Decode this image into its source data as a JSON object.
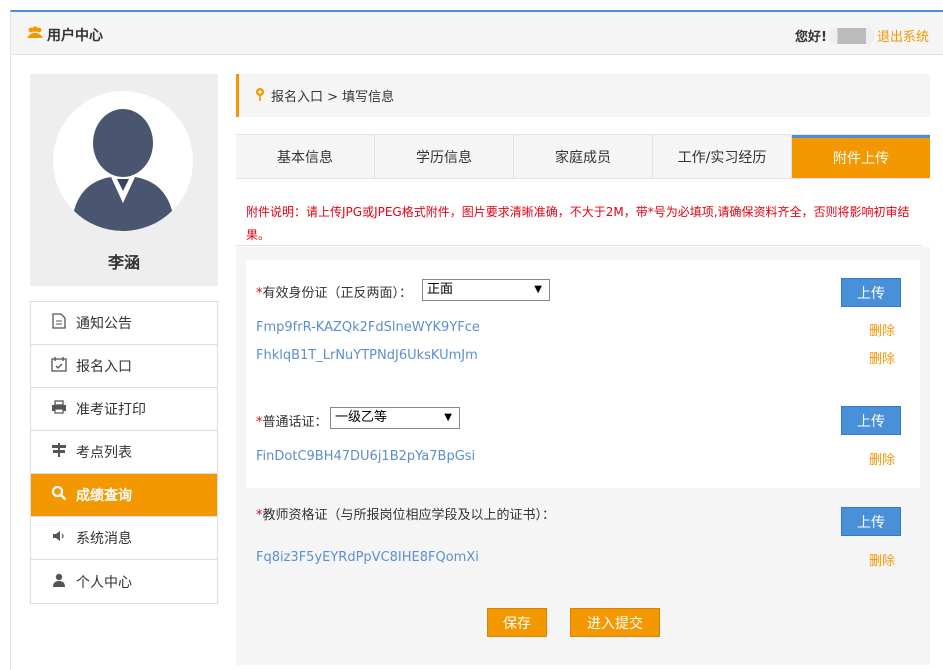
{
  "header": {
    "title": "用户中心",
    "greeting": "您好!",
    "logout": "退出系统"
  },
  "profile": {
    "name": "李涵"
  },
  "menu": {
    "items": [
      {
        "label": "通知公告",
        "icon": "document-icon"
      },
      {
        "label": "报名入口",
        "icon": "calendar-icon"
      },
      {
        "label": "准考证打印",
        "icon": "printer-icon"
      },
      {
        "label": "考点列表",
        "icon": "signpost-icon"
      },
      {
        "label": "成绩查询",
        "icon": "search-icon"
      },
      {
        "label": "系统消息",
        "icon": "speaker-icon"
      },
      {
        "label": "个人中心",
        "icon": "user-icon"
      }
    ],
    "active": "成绩查询"
  },
  "breadcrumb": {
    "path": "报名入口 > 填写信息"
  },
  "tabs": [
    {
      "label": "基本信息"
    },
    {
      "label": "学历信息"
    },
    {
      "label": "家庭成员"
    },
    {
      "label": "工作/实习经历"
    },
    {
      "label": "附件上传"
    }
  ],
  "notice": "附件说明：请上传JPG或JPEG格式附件，图片要求清晰准确，不大于2M，带*号为必填项,请确保资料齐全，否则将影响初审结果。",
  "attachments": {
    "id_card": {
      "required_mark": "*",
      "label": "有效身份证（正反两面）：",
      "selected": "正面",
      "upload": "上传",
      "files": [
        {
          "name": "Fmp9frR-KAZQk2FdSlneWYK9YFce",
          "delete": "删除"
        },
        {
          "name": "FhklqB1T_LrNuYTPNdJ6UksKUmJm",
          "delete": "删除"
        }
      ]
    },
    "mandarin": {
      "required_mark": "*",
      "label": "普通话证：",
      "selected": "一级乙等",
      "upload": "上传",
      "files": [
        {
          "name": "FinDotC9BH47DU6j1B2pYa7BpGsi",
          "delete": "删除"
        }
      ]
    },
    "teacher_cert": {
      "required_mark": "*",
      "label": "教师资格证（与所报岗位相应学段及以上的证书）：",
      "upload": "上传",
      "files": [
        {
          "name": "Fq8iz3F5yEYRdPpVC8IHE8FQomXi",
          "delete": "删除"
        }
      ]
    }
  },
  "actions": {
    "save": "保存",
    "submit": "进入提交"
  },
  "colors": {
    "accent": "#f39800",
    "primary": "#4a90d9",
    "warning_text": "#e60012"
  }
}
